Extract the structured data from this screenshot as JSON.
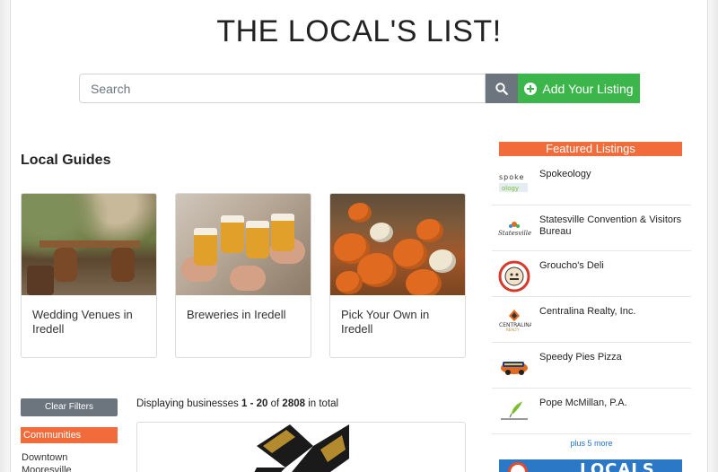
{
  "site": {
    "title": "THE LOCAL'S LIST!"
  },
  "search": {
    "placeholder": "Search",
    "add_listing_label": "Add Your Listing"
  },
  "local_guides": {
    "heading": "Local Guides",
    "items": [
      {
        "label": "Wedding Venues in Iredell"
      },
      {
        "label": "Breweries in Iredell"
      },
      {
        "label": "Pick Your Own in Iredell"
      }
    ]
  },
  "filters": {
    "clear_label": "Clear Filters",
    "communities_label": "Communities",
    "communities": [
      "Downtown",
      "Mooresville"
    ]
  },
  "results": {
    "prefix": "Displaying businesses",
    "range": "1 - 20",
    "of_text": "of",
    "total": "2808",
    "suffix": "in total"
  },
  "featured": {
    "heading": "Featured Listings",
    "items": [
      {
        "name": "Spokeology",
        "logo_text": "spoke ology"
      },
      {
        "name": "Statesville Convention & Visitors Bureau",
        "logo_text": "Statesville"
      },
      {
        "name": "Groucho's Deli",
        "logo_text": ""
      },
      {
        "name": "Centralina Realty, Inc.",
        "logo_text": "CENTRALINA REALTY"
      },
      {
        "name": "Speedy Pies Pizza",
        "logo_text": ""
      },
      {
        "name": "Pope McMillan, P.A.",
        "logo_text": ""
      }
    ],
    "more_label": "plus 5 more"
  },
  "banner": {
    "text": "LOCALS"
  },
  "colors": {
    "accent_orange": "#f26b3a",
    "green": "#3cb54a",
    "gray": "#6c757d",
    "link_blue": "#1e73d6"
  }
}
